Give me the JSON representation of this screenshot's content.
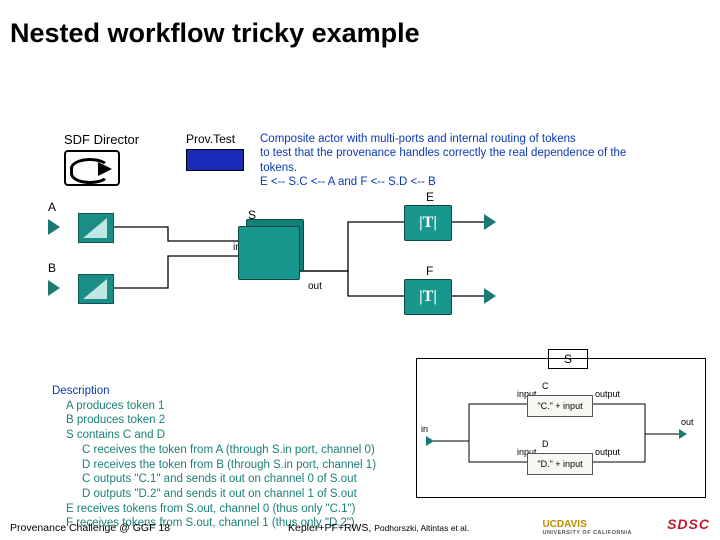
{
  "title": "Nested workflow tricky example",
  "director": {
    "label": "SDF Director"
  },
  "provTest": {
    "label": "Prov.Test"
  },
  "composite": {
    "line1": "Composite actor with multi-ports and internal routing of tokens",
    "line2": "to test that the provenance handles correctly the real dependence of the tokens.",
    "line3": "E <-- S.C <-- A  and  F <-- S.D <-- B"
  },
  "wf": {
    "A": "A",
    "B": "B",
    "S": "S",
    "E": "E",
    "F": "F",
    "T": "|T|",
    "in": "in",
    "out": "out"
  },
  "description": {
    "header": "Description",
    "l1": "A produces token 1",
    "l2": "B produces token 2",
    "l3": "S contains C and D",
    "l4": "C receives the token from A (through S.in port, channel 0)",
    "l5": "D receives the token from B (through S.in port, channel 1)",
    "l6": "C outputs \"C.1\" and sends it out on channel 0 of S.out",
    "l7": "D outputs \"D.2\" and sends it out on channel 1 of S.out",
    "l8": "E receives tokens from S.out, channel 0 (thus only \"C.1\")",
    "l9": "F receives tokens from S.out, channel 1 (thus only \"D.2\")"
  },
  "subS": {
    "label": "S",
    "in": "in",
    "out": "out",
    "C": "C",
    "D": "D",
    "Cexpr": "\"C.\" + input",
    "Dexpr": "\"D.\" + input",
    "input": "input",
    "output": "output"
  },
  "footer": {
    "left": "Provenance Challenge @ GGF 18",
    "midMain": "Kepler+PF+RWS, ",
    "midAuth": "Podhorszki, Altintas et al.",
    "ucdavis": "UCDAVIS",
    "ucdavisSub": "UNIVERSITY OF CALIFORNIA",
    "sdsc": "SDSC"
  }
}
